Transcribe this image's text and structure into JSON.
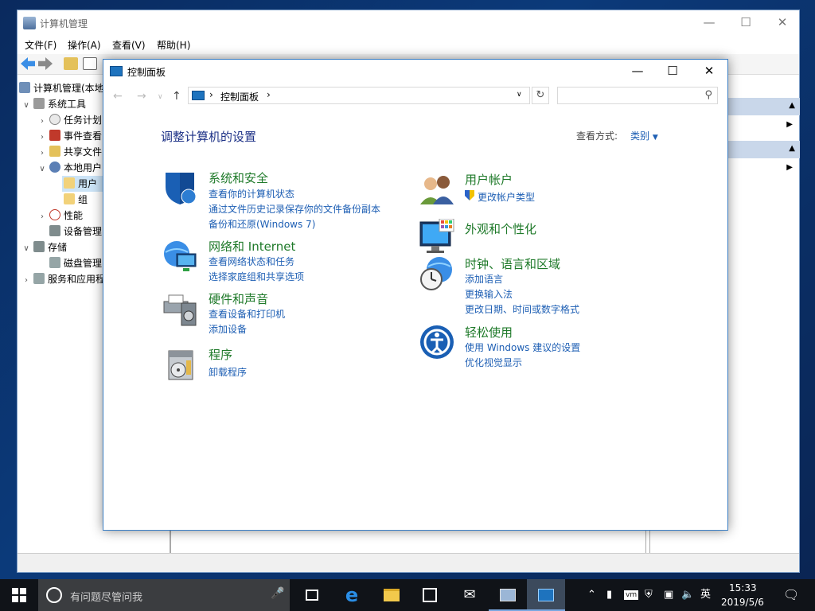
{
  "cm": {
    "title": "计算机管理",
    "menu": [
      "文件(F)",
      "操作(A)",
      "查看(V)",
      "帮助(H)"
    ],
    "tree": {
      "root": "计算机管理(本地",
      "system_tools": "系统工具",
      "task_scheduler": "任务计划",
      "event_viewer": "事件查看",
      "shared_folders": "共享文件",
      "local_users": "本地用户",
      "users": "用户",
      "groups": "组",
      "performance": "性能",
      "device_manager": "设备管理",
      "storage": "存储",
      "disk_management": "磁盘管理",
      "services_apps": "服务和应用程"
    }
  },
  "cp": {
    "title": "控制面板",
    "breadcrumb": "控制面板",
    "heading": "调整计算机的设置",
    "view_by_label": "查看方式:",
    "view_by_value": "类别",
    "categories": [
      {
        "title": "系统和安全",
        "links": [
          "查看你的计算机状态",
          "通过文件历史记录保存你的文件备份副本",
          "备份和还原(Windows 7)"
        ]
      },
      {
        "title": "网络和 Internet",
        "links": [
          "查看网络状态和任务",
          "选择家庭组和共享选项"
        ]
      },
      {
        "title": "硬件和声音",
        "links": [
          "查看设备和打印机",
          "添加设备"
        ]
      },
      {
        "title": "程序",
        "links": [
          "卸载程序"
        ]
      },
      {
        "title": "用户帐户",
        "links": [
          "更改帐户类型"
        ]
      },
      {
        "title": "外观和个性化",
        "links": []
      },
      {
        "title": "时钟、语言和区域",
        "links": [
          "添加语言",
          "更换输入法",
          "更改日期、时间或数字格式"
        ]
      },
      {
        "title": "轻松使用",
        "links": [
          "使用 Windows 建议的设置",
          "优化视觉显示"
        ]
      }
    ]
  },
  "taskbar": {
    "search_placeholder": "有问题尽管问我",
    "ime": "英",
    "time": "15:33",
    "date": "2019/5/6"
  },
  "colors": {
    "link": "#1e5fb4",
    "category_title": "#1f7a2a",
    "heading": "#1e3287",
    "taskbar": "#101318"
  }
}
